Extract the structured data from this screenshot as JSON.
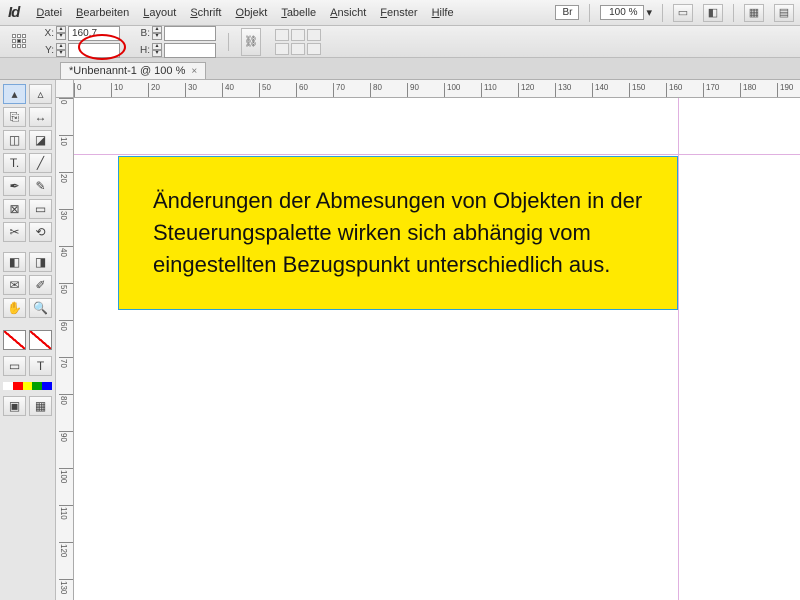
{
  "app_name": "Id",
  "menu": [
    "Datei",
    "Bearbeiten",
    "Layout",
    "Schrift",
    "Objekt",
    "Tabelle",
    "Ansicht",
    "Fenster",
    "Hilfe"
  ],
  "menu_underline_idx": [
    0,
    0,
    0,
    0,
    0,
    0,
    0,
    0,
    0
  ],
  "br_label": "Br",
  "zoom_value": "100 %",
  "control": {
    "x_label": "X:",
    "y_label": "Y:",
    "w_label": "B:",
    "h_label": "H:",
    "x_value": "160,7 mm",
    "y_value": "",
    "w_value": "",
    "h_value": ""
  },
  "tab": {
    "title": "*Unbenannt-1 @ 100 %",
    "close": "×"
  },
  "ruler_h_labels": [
    "0",
    "10",
    "20",
    "30",
    "40",
    "50",
    "60",
    "70",
    "80",
    "90",
    "100",
    "110",
    "120",
    "130",
    "140",
    "150",
    "160",
    "170",
    "180",
    "190"
  ],
  "ruler_v_labels": [
    "0",
    "10",
    "20",
    "30",
    "40",
    "50",
    "60",
    "70",
    "80",
    "90",
    "100",
    "110",
    "120",
    "130"
  ],
  "textbox_content": "Änderungen der Abmesungen von Objekten in der Steuerungspalette wirken sich abhängig vom eingestellten Bezugspunkt unterschiedlich aus.",
  "colors": {
    "yellow": "#ffe900",
    "guide": "#2aa0d8",
    "accent_red": "#e00000"
  },
  "swatch_strip": [
    "#ffffff",
    "#ff0000",
    "#ffff00",
    "#00a000",
    "#0000ff"
  ]
}
